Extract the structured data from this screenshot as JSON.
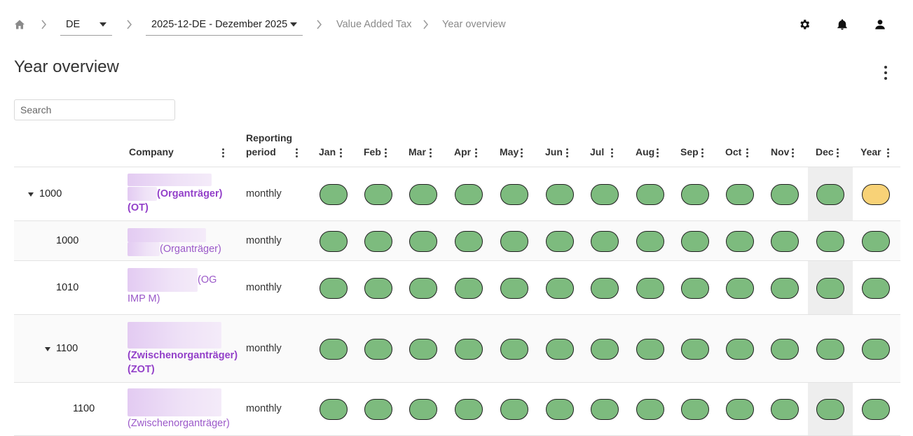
{
  "breadcrumb": {
    "country_select": "DE",
    "period_select": "2025-12-DE - Dezember 2025",
    "links": [
      "Value Added Tax",
      "Year overview"
    ]
  },
  "header_icons": [
    "gear-icon",
    "bell-icon",
    "user-icon"
  ],
  "page": {
    "title": "Year overview"
  },
  "search": {
    "placeholder": "Search",
    "value": ""
  },
  "table": {
    "columns": {
      "company": "Company",
      "period": "Reporting period",
      "months": [
        "Jan",
        "Feb",
        "Mar",
        "Apr",
        "May",
        "Jun",
        "Jul",
        "Aug",
        "Sep",
        "Oct",
        "Nov",
        "Dec",
        "Year"
      ]
    },
    "highlighted_column": "Dec",
    "status_colors": {
      "done": "#7dbb7e",
      "pending": "#f8d277"
    },
    "rows": [
      {
        "id": "1000",
        "expanded": true,
        "level": 0,
        "company_suffix": "(Organträger)",
        "company_tail": "(OT)",
        "period": "monthly",
        "statuses": [
          "done",
          "done",
          "done",
          "done",
          "done",
          "done",
          "done",
          "done",
          "done",
          "done",
          "done",
          "done",
          "pending"
        ]
      },
      {
        "id": "1000",
        "expanded": false,
        "level": 1,
        "company_suffix": "(Organträger)",
        "company_tail": "",
        "period": "monthly",
        "statuses": [
          "done",
          "done",
          "done",
          "done",
          "done",
          "done",
          "done",
          "done",
          "done",
          "done",
          "done",
          "done",
          "done"
        ]
      },
      {
        "id": "1010",
        "expanded": false,
        "level": 1,
        "company_suffix": "(OG",
        "company_tail": "IMP M)",
        "period": "monthly",
        "statuses": [
          "done",
          "done",
          "done",
          "done",
          "done",
          "done",
          "done",
          "done",
          "done",
          "done",
          "done",
          "done",
          "done"
        ]
      },
      {
        "id": "1100",
        "expanded": true,
        "level": 1,
        "company_suffix": "(Zwischenorganträger)",
        "company_tail": "(ZOT)",
        "period": "monthly",
        "statuses": [
          "done",
          "done",
          "done",
          "done",
          "done",
          "done",
          "done",
          "done",
          "done",
          "done",
          "done",
          "done",
          "done"
        ]
      },
      {
        "id": "1100",
        "expanded": false,
        "level": 2,
        "company_suffix": "",
        "company_tail": "(Zwischenorganträger)",
        "period": "monthly",
        "statuses": [
          "done",
          "done",
          "done",
          "done",
          "done",
          "done",
          "done",
          "done",
          "done",
          "done",
          "done",
          "done",
          "done"
        ]
      }
    ]
  }
}
